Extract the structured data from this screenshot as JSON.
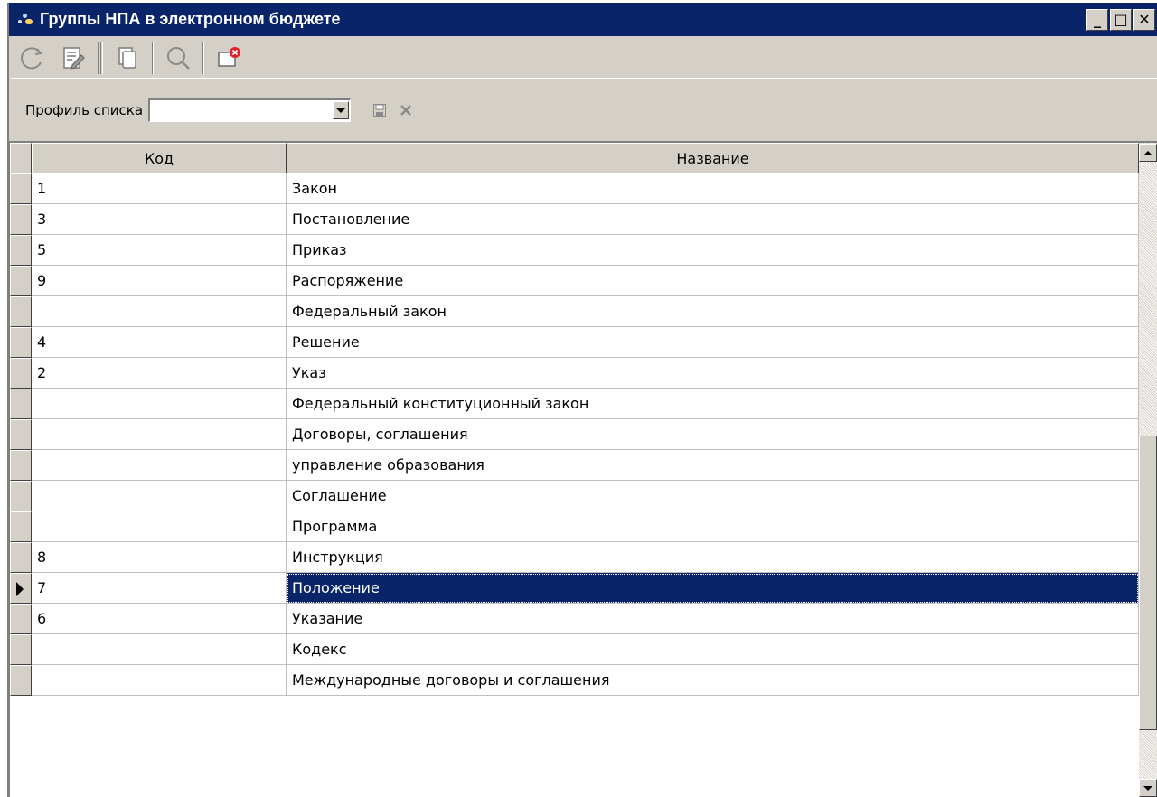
{
  "window": {
    "title": "Группы НПА в электронном бюджете",
    "minimize_label": "_",
    "maximize_label": "□",
    "close_label": "✕"
  },
  "toolbar": {
    "buttons": [
      {
        "name": "refresh",
        "icon": "refresh-icon"
      },
      {
        "name": "edit",
        "icon": "edit-document-icon"
      },
      {
        "name": "copy",
        "icon": "copy-icon"
      },
      {
        "name": "search",
        "icon": "search-icon"
      },
      {
        "name": "close-window",
        "icon": "close-window-icon"
      }
    ]
  },
  "profile": {
    "label": "Профиль списка",
    "value": ""
  },
  "grid": {
    "columns": [
      "Код",
      "Название"
    ],
    "rows": [
      {
        "code": "1",
        "name": "Закон"
      },
      {
        "code": "3",
        "name": "Постановление"
      },
      {
        "code": "5",
        "name": "Приказ"
      },
      {
        "code": "9",
        "name": "Распоряжение"
      },
      {
        "code": "",
        "name": "Федеральный закон"
      },
      {
        "code": "4",
        "name": "Решение"
      },
      {
        "code": "2",
        "name": "Указ"
      },
      {
        "code": "",
        "name": "Федеральный конституционный закон"
      },
      {
        "code": "",
        "name": "Договоры, соглашения"
      },
      {
        "code": "",
        "name": "управление образования"
      },
      {
        "code": "",
        "name": "Соглашение"
      },
      {
        "code": "",
        "name": "Программа"
      },
      {
        "code": "8",
        "name": "Инструкция"
      },
      {
        "code": "7",
        "name": "Положение"
      },
      {
        "code": "6",
        "name": "Указание"
      },
      {
        "code": "",
        "name": "Кодекс"
      },
      {
        "code": "",
        "name": "Международные договоры и соглашения"
      }
    ],
    "selected_index": 13
  },
  "colors": {
    "title_bar": "#0a246a",
    "selection": "#0a246a",
    "face": "#d4d0c8",
    "close_badge": "#e0202a"
  }
}
